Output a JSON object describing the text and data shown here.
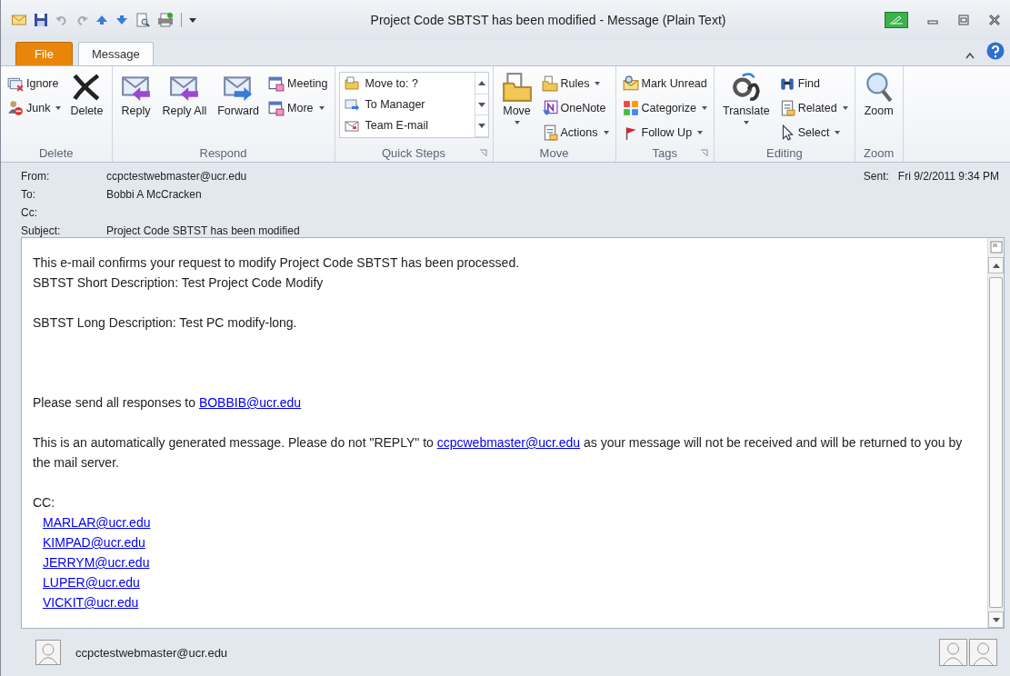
{
  "window": {
    "title": "Project Code SBTST has been modified - Message (Plain Text)"
  },
  "tabs": [
    {
      "label": "File",
      "kind": "file",
      "selected": false
    },
    {
      "label": "Message",
      "kind": "tab",
      "selected": true
    }
  ],
  "ribbon": {
    "groups": [
      {
        "label": "Delete",
        "columns": [
          {
            "kind": "small",
            "items": [
              {
                "label": "Ignore"
              },
              {
                "label": "Junk",
                "dropdown": true
              }
            ]
          },
          {
            "kind": "large",
            "items": [
              {
                "label": "Delete"
              }
            ]
          }
        ]
      },
      {
        "label": "Respond",
        "columns": [
          {
            "kind": "large",
            "items": [
              {
                "label": "Reply"
              }
            ]
          },
          {
            "kind": "large",
            "items": [
              {
                "label": "Reply All"
              }
            ]
          },
          {
            "kind": "large",
            "items": [
              {
                "label": "Forward"
              }
            ]
          },
          {
            "kind": "small",
            "items": [
              {
                "label": "Meeting"
              },
              {
                "label": "More",
                "dropdown": true
              }
            ]
          }
        ]
      },
      {
        "label": "Quick Steps",
        "launcher": true,
        "columns": [
          {
            "kind": "gallery",
            "items": [
              {
                "label": "Move to: ?"
              },
              {
                "label": "To Manager"
              },
              {
                "label": "Team E-mail"
              }
            ]
          }
        ]
      },
      {
        "label": "Move",
        "columns": [
          {
            "kind": "large",
            "items": [
              {
                "label": "Move",
                "dropdown": true
              }
            ]
          },
          {
            "kind": "small",
            "items": [
              {
                "label": "Rules",
                "dropdown": true
              },
              {
                "label": "OneNote"
              },
              {
                "label": "Actions",
                "dropdown": true
              }
            ]
          }
        ]
      },
      {
        "label": "Tags",
        "launcher": true,
        "columns": [
          {
            "kind": "small",
            "items": [
              {
                "label": "Mark Unread"
              },
              {
                "label": "Categorize",
                "dropdown": true
              },
              {
                "label": "Follow Up",
                "dropdown": true
              }
            ]
          }
        ]
      },
      {
        "label": "Editing",
        "columns": [
          {
            "kind": "large",
            "items": [
              {
                "label": "Translate",
                "dropdown": true
              }
            ]
          },
          {
            "kind": "small",
            "items": [
              {
                "label": "Find"
              },
              {
                "label": "Related",
                "dropdown": true
              },
              {
                "label": "Select",
                "dropdown": true
              }
            ]
          }
        ]
      },
      {
        "label": "Zoom",
        "columns": [
          {
            "kind": "large",
            "items": [
              {
                "label": "Zoom"
              }
            ]
          }
        ]
      }
    ]
  },
  "header": {
    "fields": [
      {
        "label": "From:",
        "value": "ccpctestwebmaster@ucr.edu"
      },
      {
        "label": "To:",
        "value": "Bobbi A McCracken"
      },
      {
        "label": "Cc:"
      },
      {
        "label": "Subject:",
        "value": "Project Code SBTST has been modified"
      }
    ],
    "sent": {
      "label": "Sent:",
      "value": "Fri 9/2/2011 9:34 PM"
    }
  },
  "body": {
    "paragraphs": [
      {
        "lines": [
          [
            {
              "text": "This e-mail confirms your request to modify Project Code SBTST has been processed."
            }
          ],
          [
            {
              "text": "SBTST Short Description: Test Project Code Modify"
            }
          ]
        ]
      },
      {
        "lines": [
          [
            {
              "text": "SBTST Long Description: Test PC modify-long."
            }
          ]
        ]
      },
      {
        "lines": [
          [
            {
              "text": "Please send all responses to "
            },
            {
              "link": "BOBBIB@ucr.edu"
            }
          ]
        ]
      },
      {
        "lines": [
          [
            {
              "text": "This is an automatically generated message. Please do not \"REPLY\" to "
            },
            {
              "link": "ccpcwebmaster@ucr.edu"
            },
            {
              "text": " as your message will not be received and will be returned to you by the mail server."
            }
          ]
        ]
      }
    ],
    "cc": {
      "label": "CC:",
      "links": [
        "MARLAR@ucr.edu",
        "KIMPAD@ucr.edu",
        "JERRYM@ucr.edu",
        "LUPER@ucr.edu",
        "VICKIT@ucr.edu"
      ]
    }
  },
  "people_pane": {
    "sender": "ccpctestwebmaster@ucr.edu"
  }
}
